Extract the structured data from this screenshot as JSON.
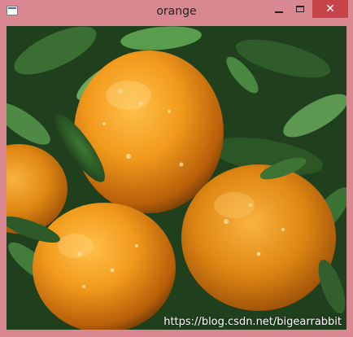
{
  "window": {
    "title": "orange",
    "close_symbol": "✕",
    "icons": {
      "app": "window-app-icon",
      "minimize": "minimize-icon",
      "maximize": "maximize-icon",
      "close": "close-icon"
    }
  },
  "image": {
    "subject": "photo-oranges-on-tree",
    "watermark": "https://blog.csdn.net/bigearrabbit"
  },
  "colors": {
    "frame": "#d98892",
    "close_button": "#c7434a"
  }
}
